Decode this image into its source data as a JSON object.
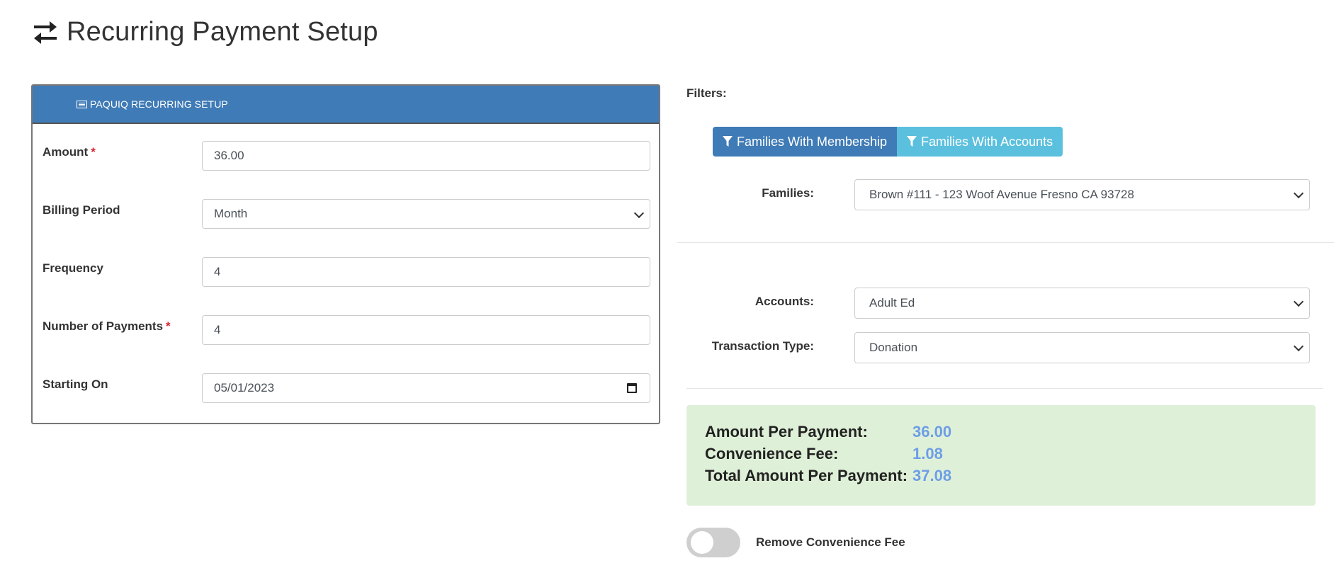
{
  "page": {
    "title": "Recurring Payment Setup"
  },
  "card": {
    "header": "PAQUIQ RECURRING SETUP",
    "fields": {
      "amount": {
        "label": "Amount",
        "required_mark": "*",
        "value": "36.00"
      },
      "billing_period": {
        "label": "Billing Period",
        "value": "Month"
      },
      "frequency": {
        "label": "Frequency",
        "value": "4"
      },
      "number_of_payments": {
        "label": "Number of Payments",
        "required_mark": "*",
        "value": "4"
      },
      "starting_on": {
        "label": "Starting On",
        "value": "05/01/2023"
      }
    }
  },
  "filters": {
    "label": "Filters:",
    "buttons": {
      "membership": "Families With Membership",
      "accounts": "Families With Accounts"
    }
  },
  "families": {
    "label": "Families:",
    "value": "Brown #111 - 123 Woof Avenue Fresno CA 93728"
  },
  "accounts": {
    "label": "Accounts:",
    "value": "Adult Ed"
  },
  "transaction_type": {
    "label": "Transaction Type:",
    "value": "Donation"
  },
  "summary": {
    "amount_per_payment": {
      "label": "Amount Per Payment:",
      "value": "36.00"
    },
    "convenience_fee": {
      "label": "Convenience Fee:",
      "value": "1.08"
    },
    "total_per_payment": {
      "label": "Total Amount Per Payment:",
      "value": "37.08"
    }
  },
  "toggle": {
    "label": "Remove Convenience Fee",
    "checked": false
  },
  "colors": {
    "primary": "#3f7bb6",
    "info": "#5bc0de",
    "success_bg": "#dff0d8",
    "value_blue": "#6d9ee6",
    "required": "#d9232d"
  }
}
